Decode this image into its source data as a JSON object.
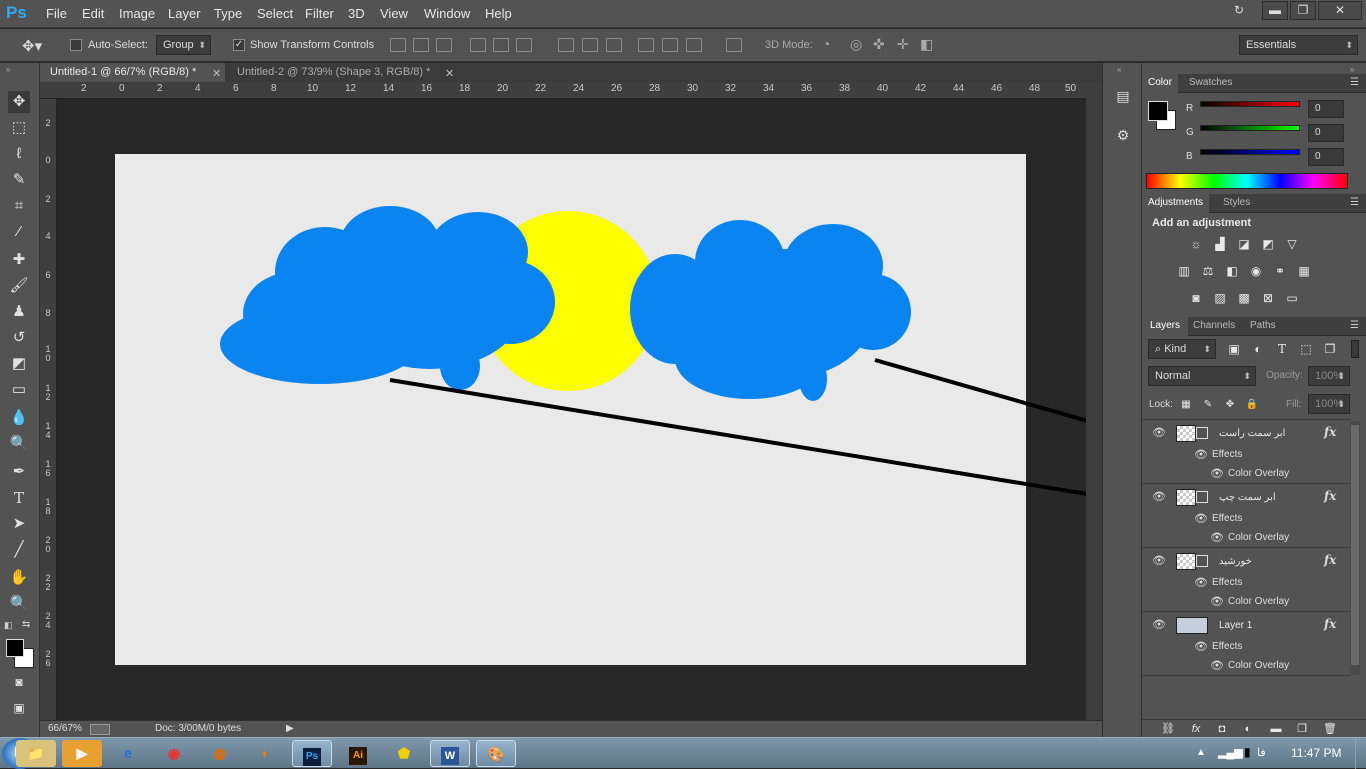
{
  "app": {
    "logo": "Ps"
  },
  "menu": [
    "File",
    "Edit",
    "Image",
    "Layer",
    "Type",
    "Select",
    "Filter",
    "3D",
    "View",
    "Window",
    "Help"
  ],
  "window_controls": {
    "minimize": "▬",
    "restore": "❐",
    "close": "✕"
  },
  "options": {
    "auto_select_label": "Auto-Select:",
    "auto_select_checked": false,
    "group_value": "Group",
    "show_transform_label": "Show Transform Controls",
    "show_transform_checked": true,
    "mode_label": "3D Mode:",
    "workspace": "Essentials"
  },
  "tabs": [
    {
      "title": "Untitled-1 @ 66/7% (RGB/8) *",
      "active": true
    },
    {
      "title": "Untitled-2 @ 73/9% (Shape 3, RGB/8) *",
      "active": false
    }
  ],
  "ruler_top": [
    "2",
    "0",
    "2",
    "4",
    "6",
    "8",
    "10",
    "12",
    "14",
    "16",
    "18",
    "20",
    "22",
    "24",
    "26",
    "28",
    "30",
    "32",
    "34",
    "36",
    "38",
    "40",
    "42",
    "44",
    "46",
    "48",
    "50"
  ],
  "ruler_left": [
    "2",
    "0",
    "2",
    "4",
    "6",
    "8",
    "1 0",
    "1 2",
    "1 4",
    "1 6",
    "1 8",
    "2 0",
    "2 2",
    "2 4",
    "2 6"
  ],
  "status": {
    "zoom": "66/67%",
    "doc": "Doc: 3/00M/0 bytes"
  },
  "color_panel": {
    "tabs": [
      "Color",
      "Swatches"
    ],
    "r_label": "R",
    "g_label": "G",
    "b_label": "B",
    "r": "0",
    "g": "0",
    "b": "0"
  },
  "adjustments": {
    "tabs": [
      "Adjustments",
      "Styles"
    ],
    "title": "Add an adjustment"
  },
  "layers_panel": {
    "tabs": [
      "Layers",
      "Channels",
      "Paths"
    ],
    "kind": "Kind",
    "blend": "Normal",
    "opacity_label": "Opacity:",
    "opacity": "100%",
    "lock_label": "Lock:",
    "fill_label": "Fill:",
    "fill": "100%",
    "effects_label": "Effects",
    "color_overlay_label": "Color Overlay",
    "fx": "fx",
    "layers": [
      {
        "name": "ابر سمت راست"
      },
      {
        "name": "ابر سمت چپ"
      },
      {
        "name": "خورشید"
      },
      {
        "name": "Layer 1"
      }
    ]
  },
  "taskbar": {
    "lang": "فا",
    "time": "11:47 PM"
  },
  "colors": {
    "sun": "#ffff00",
    "cloud": "#0a84f0",
    "canvas": "#e9e9e9"
  }
}
